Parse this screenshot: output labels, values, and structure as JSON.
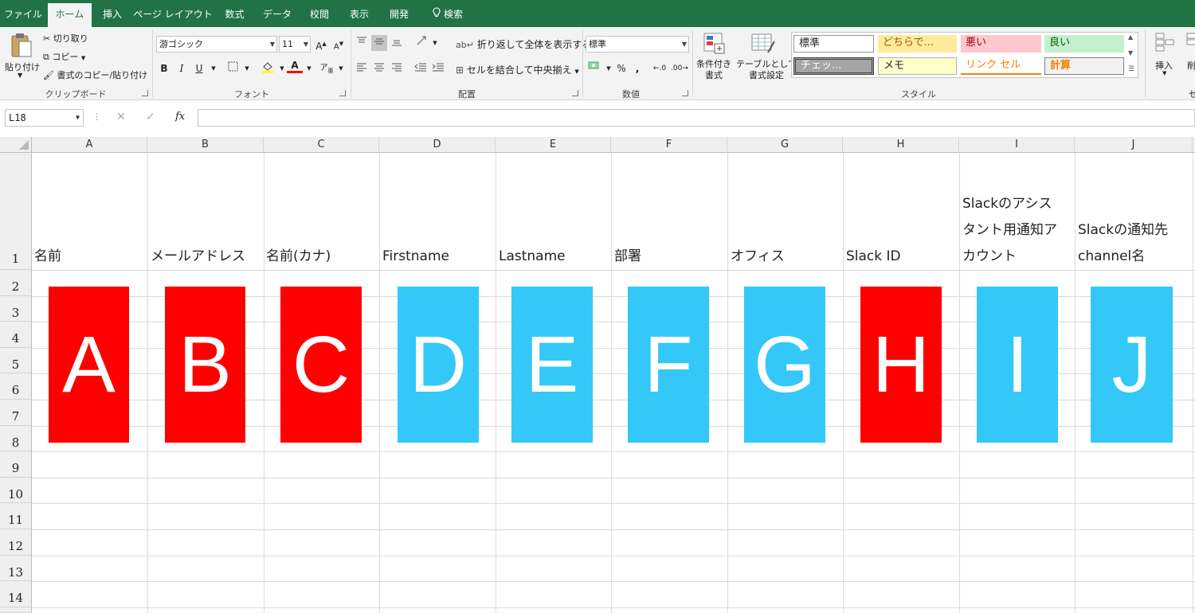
{
  "menu_tabs": [
    {
      "label": "ファイル"
    },
    {
      "label": "ホーム"
    },
    {
      "label": "挿入"
    },
    {
      "label": "ページ レイアウト"
    },
    {
      "label": "数式"
    },
    {
      "label": "データ"
    },
    {
      "label": "校閲"
    },
    {
      "label": "表示"
    },
    {
      "label": "開発"
    },
    {
      "label": "検索"
    }
  ],
  "ribbon": {
    "clipboard": {
      "paste": "貼り付け",
      "cut": "切り取り",
      "copy": "コピー",
      "format_painter": "書式のコピー/貼り付け",
      "label": "クリップボード"
    },
    "font": {
      "font_name": "游ゴシック",
      "font_size": "11",
      "bold": "B",
      "italic": "I",
      "underline": "U",
      "label": "フォント"
    },
    "alignment": {
      "wrap_text": "折り返して全体を表示する",
      "merge_center": "セルを結合して中央揃え",
      "label": "配置"
    },
    "number": {
      "format": "標準",
      "percent": "%",
      "comma": ",",
      "label": "数値"
    },
    "styles": {
      "conditional": "条件付き\n書式",
      "table": "テーブルとして\n書式設定",
      "cells": [
        {
          "label": "標準"
        },
        {
          "label": "どちらで..."
        },
        {
          "label": "悪い"
        },
        {
          "label": "良い"
        },
        {
          "label": "チェッ..."
        },
        {
          "label": "メモ"
        },
        {
          "label": "リンク セル"
        },
        {
          "label": "計算"
        }
      ],
      "label": "スタイル"
    },
    "cells_group": {
      "insert": "挿入",
      "delete_partial": "削"
    }
  },
  "formula_bar": {
    "name_box": "L18",
    "fx": "fx",
    "value": ""
  },
  "sheet": {
    "columns": [
      "A",
      "B",
      "C",
      "D",
      "E",
      "F",
      "G",
      "H",
      "I",
      "J"
    ],
    "rows": [
      "1",
      "2",
      "3",
      "4",
      "5",
      "6",
      "7",
      "8",
      "9",
      "10",
      "11",
      "12",
      "13",
      "14"
    ],
    "header_cells": [
      {
        "col": "A",
        "text": ""
      },
      {
        "col": "B",
        "text": "メールアドレス"
      },
      {
        "col": "C",
        "text": "名前(カナ)"
      },
      {
        "col": "D",
        "text": "Firstname"
      },
      {
        "col": "E",
        "text": "Lastname"
      },
      {
        "col": "F",
        "text": "部署"
      },
      {
        "col": "G",
        "text": "オフィス"
      },
      {
        "col": "H",
        "text": "Slack ID"
      },
      {
        "col": "I",
        "text": [
          "Slackのアシス",
          "タント用通知ア",
          "カウント"
        ]
      },
      {
        "col": "J",
        "text": [
          "Slackの通知先",
          "channel名"
        ]
      }
    ],
    "header_a_text": "名前",
    "blocks": [
      {
        "letter": "A",
        "color": "#ff0000"
      },
      {
        "letter": "B",
        "color": "#ff0000"
      },
      {
        "letter": "C",
        "color": "#ff0000"
      },
      {
        "letter": "D",
        "color": "#33c8f8"
      },
      {
        "letter": "E",
        "color": "#33c8f8"
      },
      {
        "letter": "F",
        "color": "#33c8f8"
      },
      {
        "letter": "G",
        "color": "#33c8f8"
      },
      {
        "letter": "H",
        "color": "#ff0000"
      },
      {
        "letter": "I",
        "color": "#33c8f8"
      },
      {
        "letter": "J",
        "color": "#33c8f8"
      }
    ]
  },
  "colors": {
    "title_bar": "#217346",
    "required": "#ff0000",
    "optional": "#33c8f8"
  }
}
